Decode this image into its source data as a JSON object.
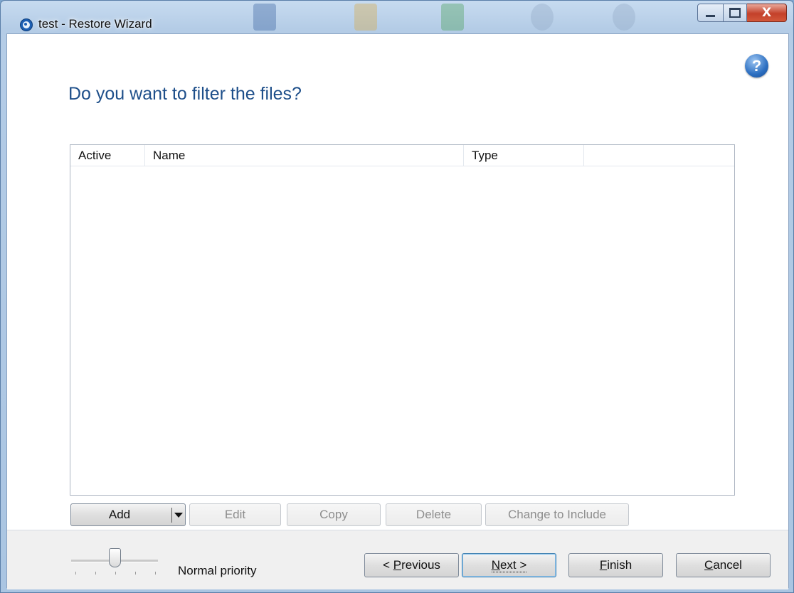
{
  "window": {
    "title": "test - Restore Wizard",
    "close_glyph": "X"
  },
  "page": {
    "heading": "Do you want to filter the files?",
    "help_glyph": "?"
  },
  "filter_list": {
    "columns": [
      "Active",
      "Name",
      "Type"
    ],
    "rows": []
  },
  "list_buttons": {
    "add": "Add",
    "edit": "Edit",
    "copy": "Copy",
    "delete": "Delete",
    "change": "Change to Include"
  },
  "footer": {
    "priority_label": "Normal priority",
    "previous": {
      "prefix": "< ",
      "mnemonic": "P",
      "rest": "revious"
    },
    "next": {
      "mnemonic": "N",
      "rest": "ext >"
    },
    "finish": {
      "mnemonic": "F",
      "rest": "inish"
    },
    "cancel": {
      "mnemonic": "C",
      "rest": "ancel"
    }
  },
  "colors": {
    "heading": "#1e4f8a",
    "titlebar": "#b4cce6",
    "close_button": "#c3402a"
  }
}
